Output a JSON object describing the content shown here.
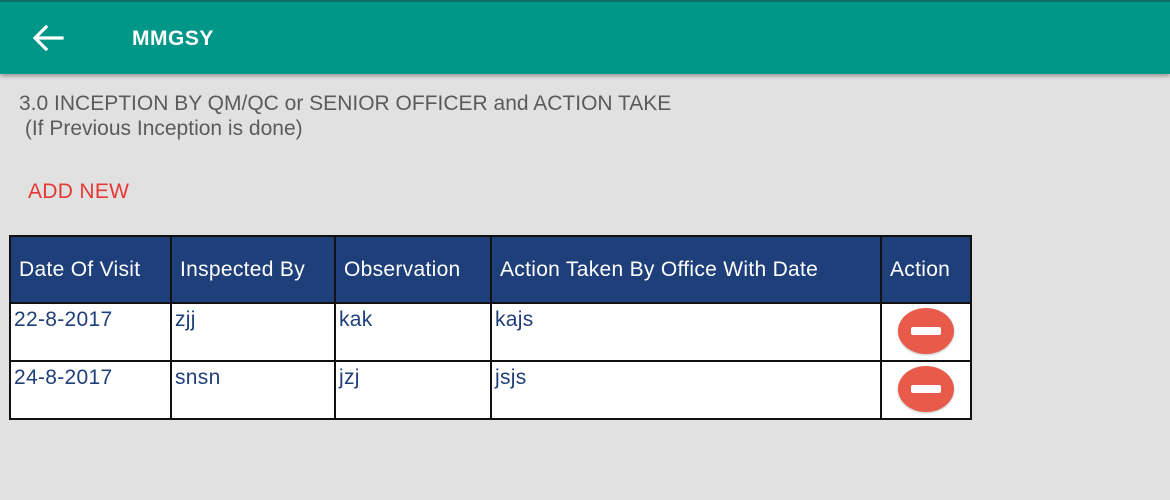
{
  "appbar": {
    "title": "MMGSY"
  },
  "section": {
    "heading": "3.0 INCEPTION BY QM/QC or SENIOR OFFICER and ACTION TAKE\n (If Previous Inception is done)"
  },
  "actions": {
    "add_new_label": "ADD NEW"
  },
  "table": {
    "headers": {
      "date": "Date Of Visit",
      "inspected_by": "Inspected By",
      "observation": "Observation",
      "action_taken": "Action Taken By Office With Date",
      "action": "Action"
    },
    "rows": [
      {
        "date": "22-8-2017",
        "inspected_by": "zjj",
        "observation": "kak",
        "action_taken": "kajs",
        "action_icon": "remove-circle-icon"
      },
      {
        "date": "24-8-2017",
        "inspected_by": "snsn",
        "observation": "jzj",
        "action_taken": "jsjs",
        "action_icon": "remove-circle-icon"
      }
    ]
  },
  "colors": {
    "appbar": "#009688",
    "table_header": "#1f3f7a",
    "add_new": "#e53935",
    "remove_button": "#e85b4a",
    "background": "#e1e1e1"
  },
  "icons": {
    "back": "arrow-back-icon"
  }
}
